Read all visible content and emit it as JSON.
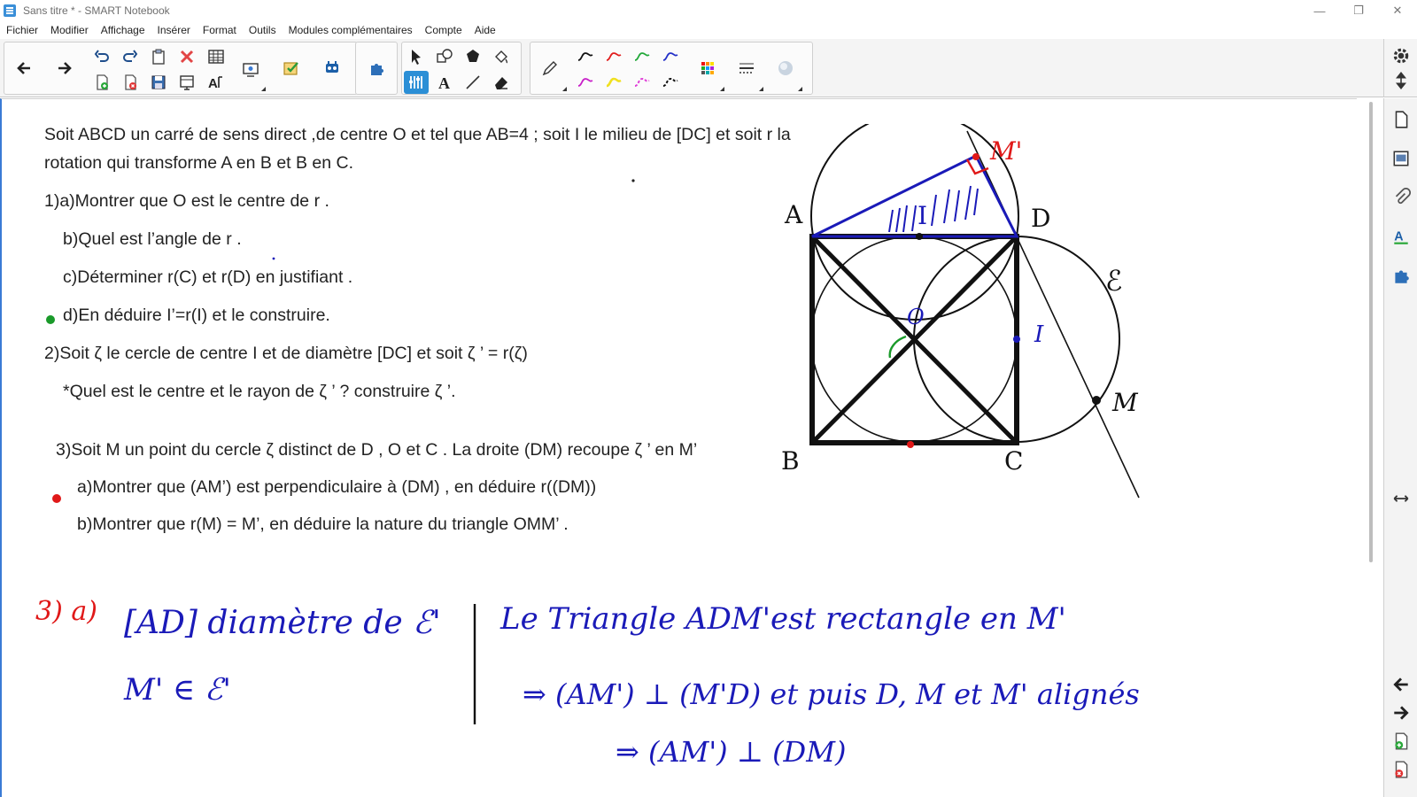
{
  "window": {
    "title": "Sans titre * - SMART Notebook",
    "controls": {
      "minimize": "—",
      "restore": "❐",
      "close": "✕"
    }
  },
  "menu": {
    "items": [
      "Fichier",
      "Modifier",
      "Affichage",
      "Insérer",
      "Format",
      "Outils",
      "Modules complémentaires",
      "Compte",
      "Aide"
    ]
  },
  "toolbar": {
    "icons": [
      "back-arrow-icon",
      "forward-arrow-icon",
      "undo-icon",
      "redo-icon",
      "paste-icon",
      "delete-icon",
      "table-icon",
      "add-page-icon",
      "delete-page-icon",
      "save-icon",
      "screen-shade-icon",
      "recognize-icon",
      "screen-capture-icon",
      "response-icon",
      "lab-activity-icon",
      "addons-icon",
      "select-icon",
      "shapes-icon",
      "polygon-icon",
      "fill-icon",
      "measure-icon",
      "text-icon",
      "line-icon",
      "eraser-icon",
      "pen-icon",
      "pen-style-icon",
      "color-palette-icon",
      "line-style-icon",
      "fill-effect-icon"
    ],
    "colors": {
      "pen_black": "#111111",
      "pen_red": "#e11d1d",
      "pen_green": "#22a83a",
      "pen_blue": "#2330c8",
      "pen_magenta": "#c81ec8",
      "pen_yellow": "#f0e020",
      "pen_pink": "#e040d8"
    }
  },
  "page": {
    "lines": [
      "Soit ABCD un carré de sens direct ,de centre O et tel que AB=4 ; soit I le milieu de [DC] et soit r la",
      "rotation qui transforme A en B et B en C.",
      "1)a)Montrer que O est le centre de r .",
      "b)Quel est l’angle de r .",
      "c)Déterminer r(C) et r(D) en justifiant .",
      "d)En déduire I’=r(I) et le construire.",
      "2)Soit ζ le cercle de centre I et de diamètre [DC] et soit ζ ’ = r(ζ)",
      "*Quel est le centre et le rayon de ζ ’ ? construire ζ ’.",
      "3)Soit M un point du cercle ζ  distinct de D , O et C . La droite (DM) recoupe ζ ’ en M’",
      "a)Montrer que (AM’) est perpendiculaire à (DM) , en déduire r((DM))",
      "b)Montrer que r(M) = M’, en déduire la nature du triangle OMM’ ."
    ],
    "figure_labels": {
      "A": "A",
      "B": "B",
      "C": "C",
      "D": "D",
      "O": "O",
      "I_top": "I",
      "I_right": "I",
      "M": "M",
      "M_prime": "M'",
      "circle": "ℰ"
    },
    "handwriting": {
      "label": "3) a)",
      "line1": "[AD] diamètre de ℰ'",
      "line2": "M' ∈ ℰ'",
      "line3": "Le Triangle ADM'est rectangle en M'",
      "line4": "⇒ (AM') ⊥ (M'D)   et puis D, M et M' alignés",
      "line5": "⇒ (AM') ⊥ (DM)"
    },
    "colors": {
      "ink_blue": "#1a1ab8",
      "ink_red": "#e01818",
      "ink_green": "#1a9a2a",
      "text": "#222222"
    }
  }
}
